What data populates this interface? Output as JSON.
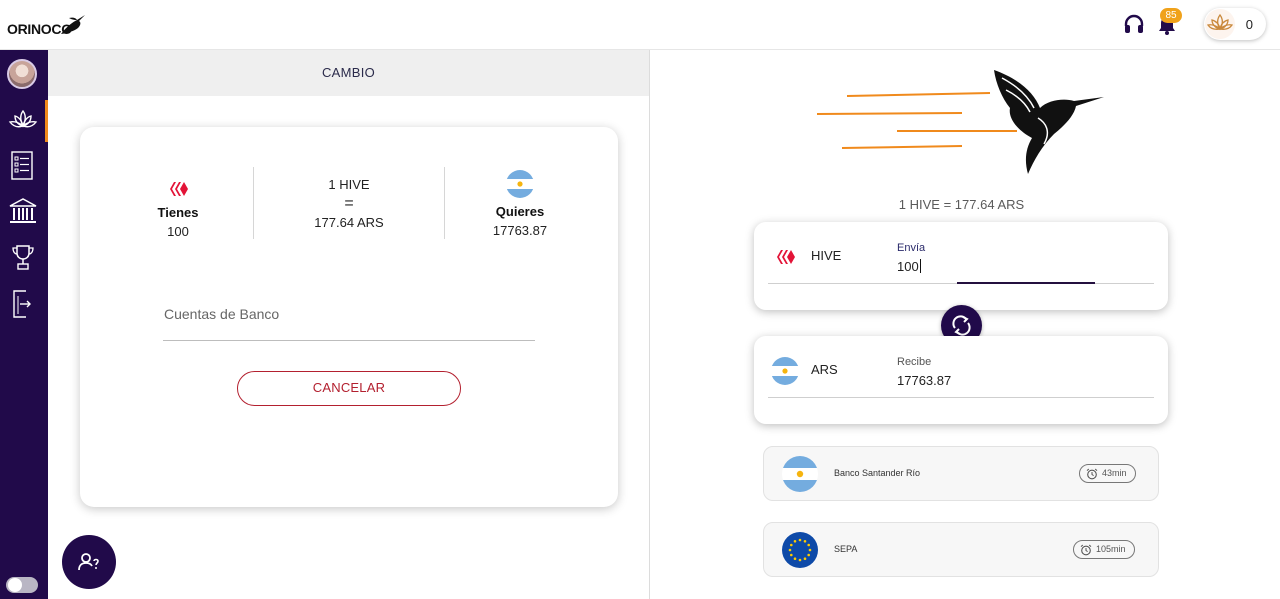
{
  "header": {
    "logo_text": "ORINOCO",
    "notification_count": "85",
    "points": "0"
  },
  "sidebar": {
    "items": [
      {
        "name": "lotus",
        "icon": "lotus-icon"
      },
      {
        "name": "checklist",
        "icon": "checklist-icon"
      },
      {
        "name": "bank",
        "icon": "bank-icon"
      },
      {
        "name": "trophy",
        "icon": "trophy-icon"
      },
      {
        "name": "exit",
        "icon": "exit-icon"
      }
    ]
  },
  "left": {
    "section_title": "CAMBIO",
    "have": {
      "label": "Tienes",
      "value": "100",
      "icon": "hive-logo-icon"
    },
    "rate": {
      "line1": "1 HIVE",
      "line2": "=",
      "line3": "177.64 ARS"
    },
    "want": {
      "label": "Quieres",
      "value": "17763.87",
      "icon": "argentina-flag-icon"
    },
    "bank_accounts_placeholder": "Cuentas de Banco",
    "cancel_label": "CANCELAR"
  },
  "right": {
    "rate_text": "1 HIVE = 177.64 ARS",
    "send": {
      "currency": "HIVE",
      "label": "Envía",
      "amount": "100"
    },
    "receive": {
      "currency": "ARS",
      "label": "Recibe",
      "amount": "17763.87"
    },
    "banks": [
      {
        "name": "Banco Santander Río",
        "time": "43min",
        "flag": "argentina-flag-icon"
      },
      {
        "name": "SEPA",
        "time": "105min",
        "flag": "eu-flag-icon"
      }
    ]
  },
  "colors": {
    "brand_dark": "#210a4a",
    "accent_orange": "#f08a1c",
    "cancel_red": "#b3202f",
    "hive_red": "#e31337",
    "badge": "#f0a21b"
  }
}
